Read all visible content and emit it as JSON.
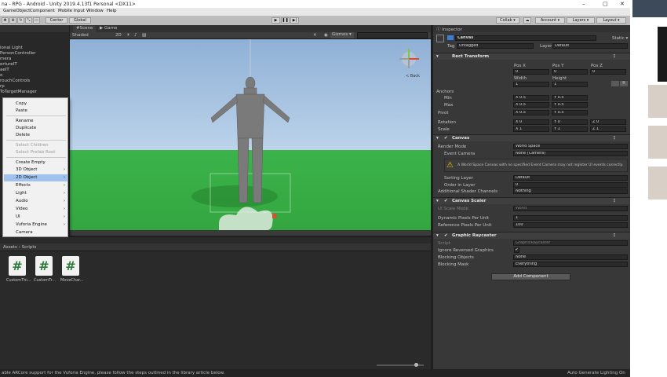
{
  "window": {
    "title": "na - RPG - Android - Unity 2019.4.13f1 Personal <DX11>"
  },
  "menu": [
    "GameObject",
    "Component",
    "Mobile Input",
    "Window",
    "Help"
  ],
  "toolbar": {
    "center": "Center",
    "global": "Global",
    "collab": "Collab ▾",
    "account": "Account ▾",
    "layers": "Layers ▾",
    "layout": "Layout ▾"
  },
  "hierarchy": {
    "items": [
      "ional Light",
      "PersonController",
      "mera",
      "ertureIT",
      "aeIT",
      "o",
      "rouchControls",
      "rp",
      "ToTargetManager"
    ]
  },
  "scene": {
    "tabs": [
      "Scene",
      "Game"
    ],
    "shading": "Shaded",
    "mode": "2D",
    "gizmos": "Gizmos ▾",
    "persp": "< Back"
  },
  "context_menu": {
    "items": [
      "Copy",
      "Paste",
      "Rename",
      "Duplicate",
      "Delete",
      "Select Children",
      "Select Prefab Root",
      "Create Empty",
      "3D Object",
      "2D Object",
      "Effects",
      "Light",
      "Audio",
      "Video",
      "UI",
      "Vuforia Engine",
      "Camera"
    ],
    "arrow": "›"
  },
  "project": {
    "breadcrumb": "Assets › Scripts",
    "files": [
      "CustomThi...",
      "CustomTr...",
      "MoveChar..."
    ]
  },
  "inspector": {
    "tab": "Inspector",
    "object": "Canvas",
    "static": "Static ▾",
    "tag_label": "Tag",
    "tag": "Untagged",
    "layer_label": "Layer",
    "layer": "Default",
    "rect": {
      "title": "Rect Transform",
      "posx_l": "Pos X",
      "posy_l": "Pos Y",
      "posz_l": "Pos Z",
      "posx": "0",
      "posy": "0",
      "posz": "0",
      "w_l": "Width",
      "h_l": "Height",
      "w": "1",
      "h": "1",
      "anchors": "Anchors",
      "min": "Min",
      "max": "Max",
      "minx": "X 0.5",
      "miny": "Y 0.5",
      "maxx": "X 0.5",
      "maxy": "Y 0.5",
      "pivot": "Pivot",
      "pivx": "X 0.5",
      "pivy": "Y 0.5",
      "rot": "Rotation",
      "rotx": "X 0",
      "roty": "Y 0",
      "rotz": "Z 0",
      "scale": "Scale",
      "sx": "X 1",
      "sy": "Y 1",
      "sz": "Z 1",
      "r": "R"
    },
    "canvas": {
      "title": "Canvas",
      "render_mode_l": "Render Mode",
      "render_mode": "World Space",
      "event_cam_l": "Event Camera",
      "event_cam": "None (Camera)",
      "warning": "A World Space Canvas with no specified Event Camera may not register UI events correctly.",
      "sort_layer_l": "Sorting Layer",
      "sort_layer": "Default",
      "order_l": "Order in Layer",
      "order": "0",
      "shader_l": "Additional Shader Channels",
      "shader": "Nothing"
    },
    "scaler": {
      "title": "Canvas Scaler",
      "mode_l": "UI Scale Mode",
      "mode": "World",
      "dpu_l": "Dynamic Pixels Per Unit",
      "dpu": "1",
      "rppu_l": "Reference Pixels Per Unit",
      "rppu": "100"
    },
    "raycaster": {
      "title": "Graphic Raycaster",
      "script_l": "Script",
      "script": "GraphicRaycaster",
      "ignore_l": "Ignore Reversed Graphics",
      "block_obj_l": "Blocking Objects",
      "block_obj": "None",
      "block_mask_l": "Blocking Mask",
      "block_mask": "Everything"
    },
    "add_component": "Add Component"
  },
  "status": {
    "left": "able ARCore support for the Vuforia Engine, please follow the steps outlined in the library article below.",
    "right": "Auto Generate Lighting On"
  }
}
